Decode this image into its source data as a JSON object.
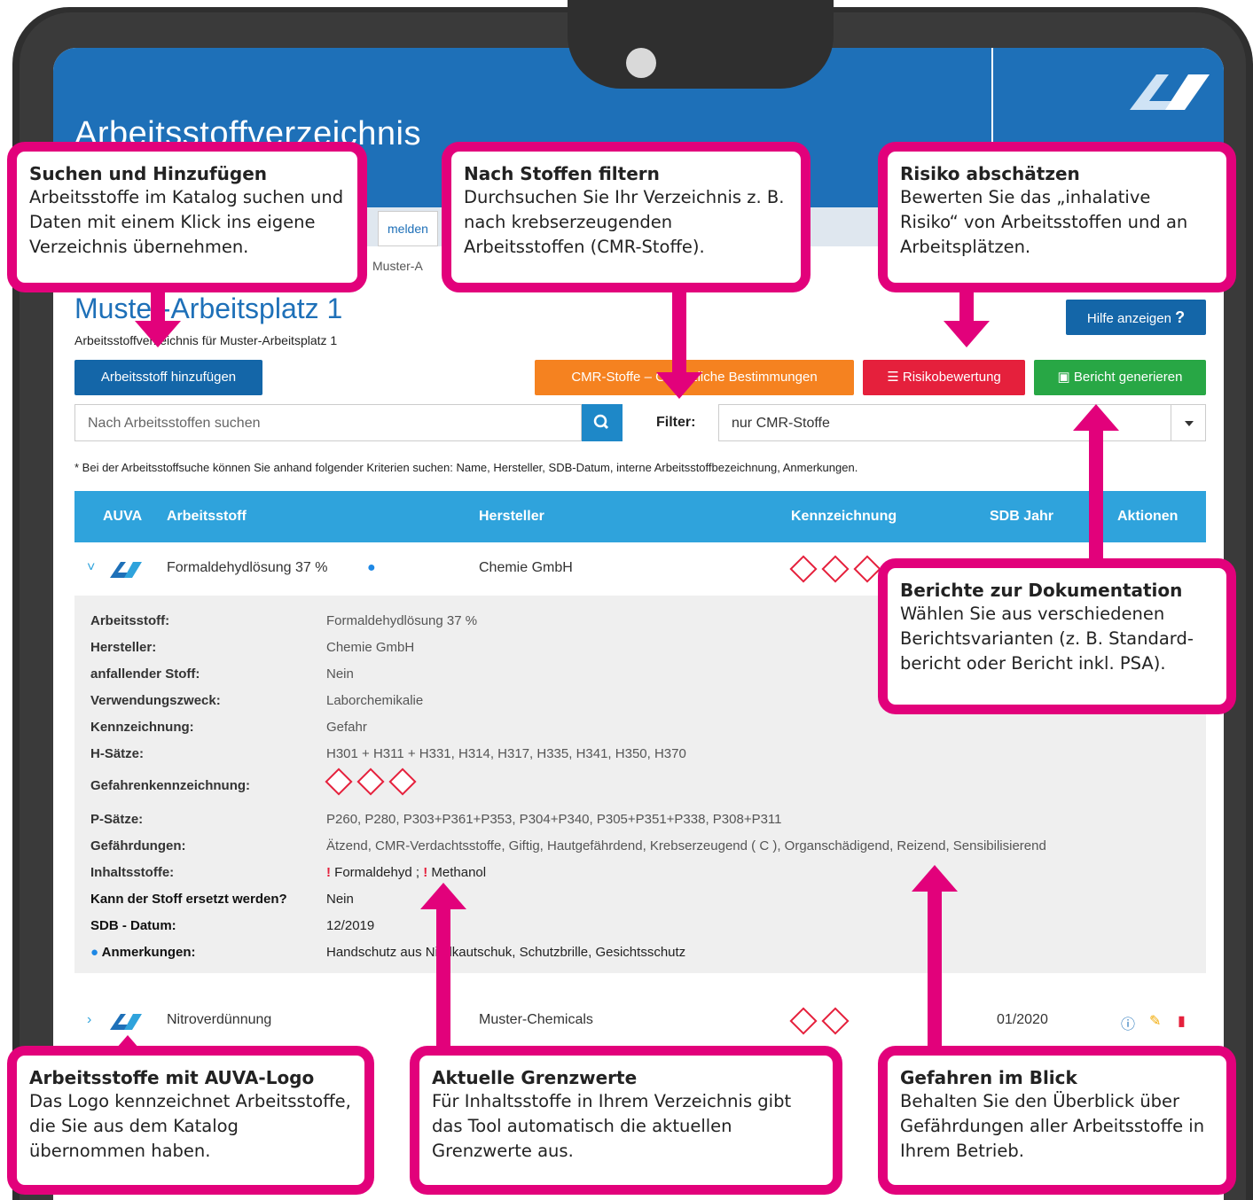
{
  "app": {
    "title": "Arbeitsstoffverzeichnis",
    "tab_label": "melden",
    "breadcrumb": "Muster-A",
    "page_title": "Muster-Arbeitsplatz 1",
    "page_subtitle": "Arbeitsstoffverzeichnis für Muster-Arbeitsplatz 1"
  },
  "buttons": {
    "help": "Hilfe anzeigen",
    "help_icon": "?",
    "add": "Arbeitsstoff hinzufügen",
    "cmr": "CMR-Stoffe – Gesetzliche Bestimmungen",
    "risk": "Risikobewertung",
    "report": "Bericht generieren"
  },
  "search": {
    "placeholder": "Nach Arbeitsstoffen suchen"
  },
  "filter": {
    "label": "Filter:",
    "selected": "nur CMR-Stoffe"
  },
  "note": "* Bei der Arbeitsstoffsuche können Sie anhand folgender Kriterien suchen: Name, Hersteller, SDB-Datum, interne Arbeitsstoffbezeichnung, Anmerkungen.",
  "table": {
    "headers": [
      "AUVA",
      "Arbeitsstoff",
      "Hersteller",
      "Kennzeichnung",
      "SDB Jahr",
      "Aktionen"
    ],
    "rows": [
      {
        "name": "Formaldehydlösung 37 %",
        "manufacturer": "Chemie GmbH",
        "year": ""
      },
      {
        "name": "Nitroverdünnung",
        "manufacturer": "Muster-Chemicals",
        "year": "01/2020"
      }
    ]
  },
  "detail": {
    "labels": [
      "Arbeitsstoff:",
      "Hersteller:",
      "anfallender Stoff:",
      "Verwendungszweck:",
      "Kennzeichnung:",
      "H-Sätze:",
      "Gefahrenkennzeichnung:",
      "P-Sätze:",
      "Gefährdungen:",
      "Inhaltsstoffe:",
      "Kann der Stoff ersetzt werden?",
      "SDB - Datum:",
      "Anmerkungen:"
    ],
    "values": {
      "substance": "Formaldehydlösung 37 %",
      "manufacturer": "Chemie GmbH",
      "incidental": "Nein",
      "use": "Laborchemikalie",
      "marking": "Gefahr",
      "h": "H301 + H311 + H331, H314, H317, H335, H341, H350, H370",
      "p": "P260, P280, P303+P361+P353, P304+P340, P305+P351+P338, P308+P311",
      "hazards": "Ätzend, CMR-Verdachtsstoffe, Giftig, Hautgefährdend, Krebserzeugend ( C ), Organschädigend, Reizend, Sensibilisierend",
      "ingredient1": "Formaldehyd ;",
      "ingredient2": "Methanol",
      "replaceable": "Nein",
      "sdb_date": "12/2019",
      "remarks": "Handschutz aus Nitrilkautschuk, Schutzbrille, Gesichtsschutz"
    }
  },
  "callouts": [
    {
      "title": "Suchen und Hinzufügen",
      "body": "Arbeitsstoffe im Katalog suchen und Daten mit einem Klick ins eigene Verzeichnis übernehmen."
    },
    {
      "title": "Nach Stoffen filtern",
      "body": "Durchsuchen Sie Ihr Verzeichnis z. B. nach krebserzeugenden Arbeitsstoffen (CMR-Stoffe)."
    },
    {
      "title": "Risiko abschätzen",
      "body": "Bewerten Sie das „inhalative Risiko“ von Arbeitsstoffen und an Arbeitsplätzen."
    },
    {
      "title": "Berichte zur Dokumentation",
      "body": "Wählen Sie aus verschiedenen Berichtsvarianten (z. B. Standard­bericht oder Bericht inkl. PSA)."
    },
    {
      "title": "Arbeitsstoffe mit AUVA-Logo",
      "body": "Das Logo kennzeichnet Arbeits­stoffe, die Sie aus dem Katalog übernommen haben."
    },
    {
      "title": "Aktuelle Grenzwerte",
      "body": "Für Inhaltsstoffe in Ihrem Verzeichnis gibt das Tool automatisch die aktuellen Grenzwerte aus."
    },
    {
      "title": "Gefahren im Blick",
      "body": "Behalten Sie den Überblick über Gefährdungen aller Arbeitsstoffe in Ihrem Betrieb."
    }
  ],
  "colors": {
    "accent": "#e2017b",
    "primary": "#1e70b8",
    "table_header": "#2fa3dc",
    "cmr": "#f58220",
    "risk": "#e5203c",
    "report": "#28a745"
  }
}
